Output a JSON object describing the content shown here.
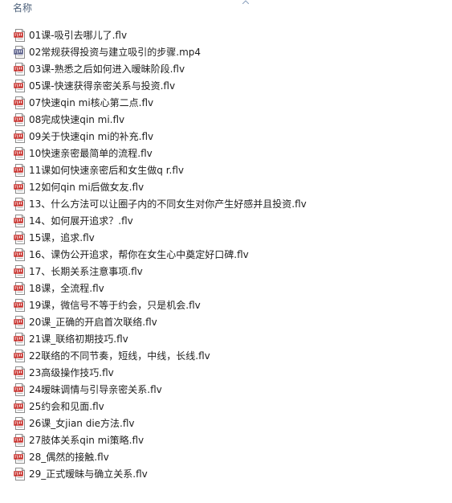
{
  "header": {
    "column_label": "名称"
  },
  "files": [
    {
      "name": "01课-吸引去哪儿了.flv",
      "icon": "flv-file-icon"
    },
    {
      "name": "02常规获得投资与建立吸引的步骤.mp4",
      "icon": "mp4-file-icon"
    },
    {
      "name": "03课-熟悉之后如何进入暧昧阶段.flv",
      "icon": "flv-file-icon"
    },
    {
      "name": "05课-快速获得亲密关系与投资.flv",
      "icon": "flv-file-icon"
    },
    {
      "name": "07快速qin mi核心第二点.flv",
      "icon": "flv-file-icon"
    },
    {
      "name": "08完成快速qin mi.flv",
      "icon": "flv-file-icon"
    },
    {
      "name": "09关于快速qin mi的补充.flv",
      "icon": "flv-file-icon"
    },
    {
      "name": "10快速亲密最简单的流程.flv",
      "icon": "flv-file-icon"
    },
    {
      "name": "11课如何快速亲密后和女生做q r.flv",
      "icon": "flv-file-icon"
    },
    {
      "name": "12如何qin mi后做女友.flv",
      "icon": "flv-file-icon"
    },
    {
      "name": "13、什么方法可以让圈子内的不同女生对你产生好感并且投资.flv",
      "icon": "flv-file-icon"
    },
    {
      "name": "14、如何展开追求？.flv",
      "icon": "flv-file-icon"
    },
    {
      "name": "15课，追求.flv",
      "icon": "flv-file-icon"
    },
    {
      "name": "16、课伪公开追求，帮你在女生心中奠定好口碑.flv",
      "icon": "flv-file-icon"
    },
    {
      "name": "17、长期关系注意事项.flv",
      "icon": "flv-file-icon"
    },
    {
      "name": "18课，全流程.flv",
      "icon": "flv-file-icon"
    },
    {
      "name": "19课，微信号不等于约会，只是机会.flv",
      "icon": "flv-file-icon"
    },
    {
      "name": "20课_正确的开启首次联络.flv",
      "icon": "flv-file-icon"
    },
    {
      "name": "21课_联络初期技巧.flv",
      "icon": "flv-file-icon"
    },
    {
      "name": "22联络的不同节奏，短线，中线，长线.flv",
      "icon": "flv-file-icon"
    },
    {
      "name": "23高级操作技巧.flv",
      "icon": "flv-file-icon"
    },
    {
      "name": "24暧昧调情与引导亲密关系.flv",
      "icon": "flv-file-icon"
    },
    {
      "name": "25约会和见面.flv",
      "icon": "flv-file-icon"
    },
    {
      "name": "26课_女jian die方法.flv",
      "icon": "flv-file-icon"
    },
    {
      "name": "27肢体关系qin mi策略.flv",
      "icon": "flv-file-icon"
    },
    {
      "name": "28_偶然的接触.flv",
      "icon": "flv-file-icon"
    },
    {
      "name": "29_正式暧昧与确立关系.flv",
      "icon": "flv-file-icon"
    }
  ],
  "colors": {
    "flv_icon": "#c8302c",
    "mp4_icon": "#5a5f8a",
    "header_text": "#4c607a"
  }
}
